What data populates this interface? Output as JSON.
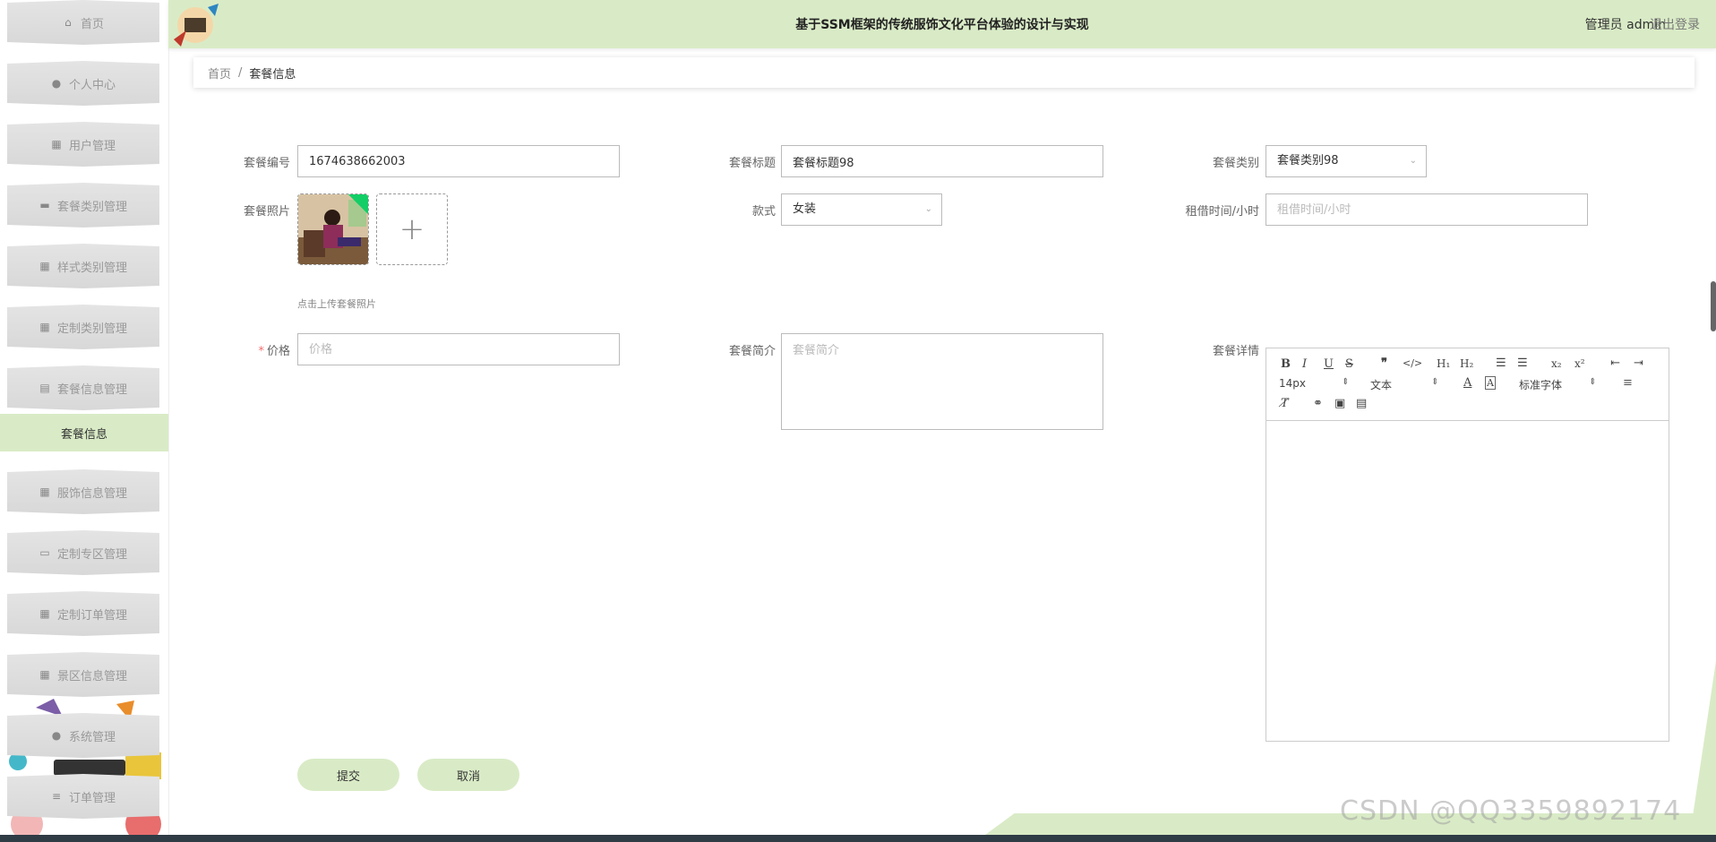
{
  "header": {
    "title": "基于SSM框架的传统服饰文化平台体验的设计与实现",
    "user": "管理员 admin",
    "logout": "退出登录"
  },
  "sidebar": {
    "items": [
      {
        "label": "首页",
        "icon": "home-icon"
      },
      {
        "label": "个人中心",
        "icon": "user-icon"
      },
      {
        "label": "用户管理",
        "icon": "grid-icon"
      },
      {
        "label": "套餐类别管理",
        "icon": "briefcase-icon"
      },
      {
        "label": "样式类别管理",
        "icon": "grid-icon"
      },
      {
        "label": "定制类别管理",
        "icon": "grid-icon"
      },
      {
        "label": "套餐信息管理",
        "icon": "clipboard-icon"
      },
      {
        "label": "服饰信息管理",
        "icon": "grid-icon"
      },
      {
        "label": "定制专区管理",
        "icon": "monitor-icon"
      },
      {
        "label": "定制订单管理",
        "icon": "grid-icon"
      },
      {
        "label": "景区信息管理",
        "icon": "grid-icon"
      },
      {
        "label": "系统管理",
        "icon": "location-icon"
      },
      {
        "label": "订单管理",
        "icon": "list-icon"
      }
    ],
    "sub_item": "套餐信息"
  },
  "breadcrumb": {
    "home": "首页",
    "separator": "/",
    "current": "套餐信息"
  },
  "form": {
    "package_no_label": "套餐编号",
    "package_no_value": "1674638662003",
    "package_title_label": "套餐标题",
    "package_title_value": "套餐标题98",
    "package_category_label": "套餐类别",
    "package_category_value": "套餐类别98",
    "package_photo_label": "套餐照片",
    "upload_tip": "点击上传套餐照片",
    "style_label": "款式",
    "style_value": "女装",
    "rent_time_label": "租借时间/小时",
    "rent_time_placeholder": "租借时间/小时",
    "price_required_mark": "*",
    "price_label": "价格",
    "price_placeholder": "价格",
    "intro_label": "套餐简介",
    "intro_placeholder": "套餐简介",
    "detail_label": "套餐详情"
  },
  "editor": {
    "font_size": "14px",
    "text_type": "文本",
    "font_family": "标准字体"
  },
  "buttons": {
    "submit": "提交",
    "cancel": "取消"
  },
  "watermark": "CSDN @QQ3359892174",
  "colors": {
    "accent": "#d9ebc6",
    "required": "#f56c6c",
    "badge": "#13ce66"
  }
}
